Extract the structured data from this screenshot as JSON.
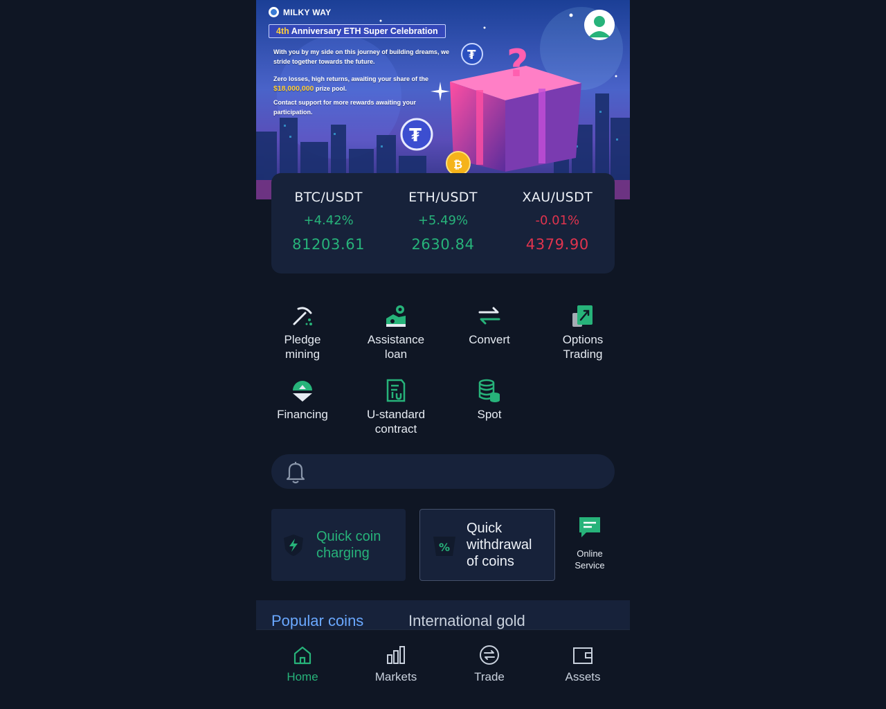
{
  "banner": {
    "brand": "MILKY WAY",
    "title_highlight": "4th",
    "title_rest": " Anniversary ETH Super Celebration",
    "line1": "With you by my side on this journey of building dreams, we stride together towards the future.",
    "line2_pre": "Zero losses, high returns, awaiting your share of the ",
    "line2_amount": "$18,000,000",
    "line2_post": " prize pool.",
    "line3": "Contact support for more rewards awaiting your participation."
  },
  "tickers": [
    {
      "pair": "BTC/USDT",
      "change": "+4.42%",
      "price": "81203.61",
      "direction": "up"
    },
    {
      "pair": "ETH/USDT",
      "change": "+5.49%",
      "price": "2630.84",
      "direction": "up"
    },
    {
      "pair": "XAU/USDT",
      "change": "-0.01%",
      "price": "4379.90",
      "direction": "down"
    }
  ],
  "functions": [
    {
      "label_1": "Pledge",
      "label_2": "mining",
      "icon": "pickaxe-icon"
    },
    {
      "label_1": "Assistance",
      "label_2": "loan",
      "icon": "loan-icon"
    },
    {
      "label_1": "Convert",
      "label_2": "",
      "icon": "convert-arrows-icon"
    },
    {
      "label_1": "Options",
      "label_2": "Trading",
      "icon": "options-chart-icon"
    },
    {
      "label_1": "Financing",
      "label_2": "",
      "icon": "financing-icon"
    },
    {
      "label_1": "U-standard",
      "label_2": "contract",
      "icon": "contract-document-icon"
    },
    {
      "label_1": "Spot",
      "label_2": "",
      "icon": "coin-stack-icon"
    }
  ],
  "notice": {
    "icon": "bell-icon",
    "text": ""
  },
  "quick_actions": {
    "charge_line1": "Quick coin",
    "charge_line2": "charging",
    "withdraw_line1": "Quick",
    "withdraw_line2": "withdrawal",
    "withdraw_line3": "of coins",
    "online_line1": "Online",
    "online_line2": "Service"
  },
  "tabs": {
    "popular": "Popular coins",
    "gold": "International gold",
    "active": "popular"
  },
  "bottom_nav": [
    {
      "label": "Home",
      "icon": "home-icon",
      "active": true
    },
    {
      "label": "Markets",
      "icon": "bar-chart-icon",
      "active": false
    },
    {
      "label": "Trade",
      "icon": "exchange-circle-icon",
      "active": false
    },
    {
      "label": "Assets",
      "icon": "wallet-icon",
      "active": false
    }
  ],
  "colors": {
    "background": "#0f1624",
    "card": "#17223a",
    "accent_green": "#27b37a",
    "down_red": "#e0344e",
    "tab_active": "#6aa8ff"
  }
}
